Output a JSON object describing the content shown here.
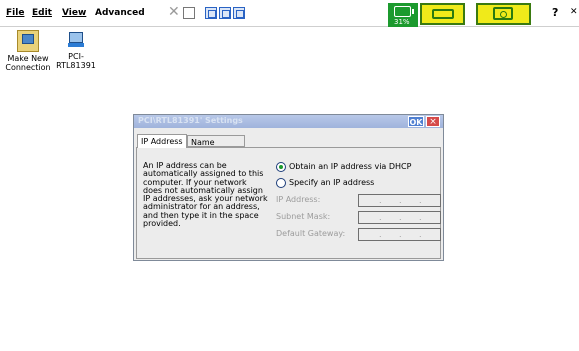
{
  "menubar": {
    "items": [
      "File",
      "Edit",
      "View",
      "Advanced"
    ],
    "battery_percent": "31%"
  },
  "desktop": {
    "icons": [
      {
        "label_line1": "Make New",
        "label_line2": "Connection"
      },
      {
        "label_line1": "PCI-",
        "label_line2": "RTL81391"
      }
    ]
  },
  "dialog": {
    "title": "PCI\\RTL81391' Settings",
    "ok_label": "OK",
    "close_label": "×",
    "tabs": [
      "IP Address",
      "Name Servers"
    ],
    "info_text": "An IP address can be\nautomatically assigned to this\ncomputer.  If your network\ndoes not automatically assign\nIP addresses, ask your network\nadministrator for an address,\nand then type it in the space\nprovided.",
    "radio_dhcp": "Obtain an IP address via DHCP",
    "radio_specify": "Specify an IP address",
    "dhcp_selected": true,
    "fields": {
      "ip_label": "IP Address:",
      "subnet_label": "Subnet Mask:",
      "gateway_label": "Default Gateway:"
    },
    "ip_dot": "."
  }
}
